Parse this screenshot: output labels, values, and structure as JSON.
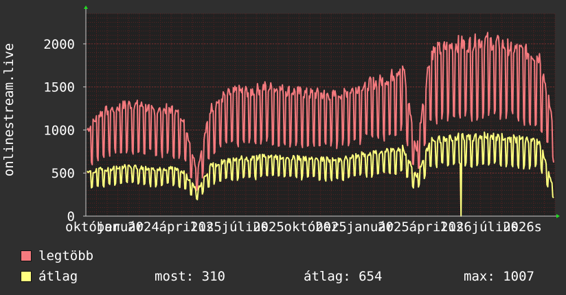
{
  "chart_data": {
    "type": "line",
    "ylabel": "onlinestream.live",
    "ylim": [
      0,
      2350
    ],
    "yticks": [
      0,
      500,
      1000,
      1500,
      2000
    ],
    "x_tick_labels": [
      "október",
      "január",
      "2024",
      "április",
      "2025",
      "július",
      "2025",
      "október",
      "2025",
      "január",
      "2025",
      "április",
      "2026",
      "július",
      "2026",
      "s",
      "202"
    ],
    "grid": true,
    "background": "#212121",
    "series": [
      {
        "name": "legtöbb",
        "color": "#f47a7e",
        "anchors": [
          1000,
          1200,
          1250,
          1300,
          1280,
          1220,
          1250,
          1150,
          520,
          1250,
          1400,
          1450,
          1450,
          1500,
          1470,
          1450,
          1420,
          1420,
          1400,
          1450,
          1520,
          1550,
          1600,
          1750,
          750,
          1900,
          1950,
          2000,
          2000,
          2050,
          2000,
          1950,
          1900,
          1850,
          1050
        ]
      },
      {
        "name": "átlag",
        "color": "#ffff7f",
        "anchors": [
          500,
          540,
          560,
          580,
          560,
          540,
          560,
          520,
          290,
          580,
          640,
          670,
          670,
          700,
          690,
          680,
          670,
          660,
          650,
          670,
          720,
          730,
          760,
          800,
          450,
          870,
          900,
          920,
          900,
          940,
          920,
          900,
          880,
          860,
          310
        ]
      }
    ]
  },
  "legend": {
    "items": [
      {
        "label": "legtöbb",
        "color": "#f47a7e"
      },
      {
        "label": "átlag",
        "color": "#ffff7f"
      }
    ],
    "stats": {
      "now": "most: 310",
      "avg": "átlag: 654",
      "max": "max: 1007"
    }
  }
}
